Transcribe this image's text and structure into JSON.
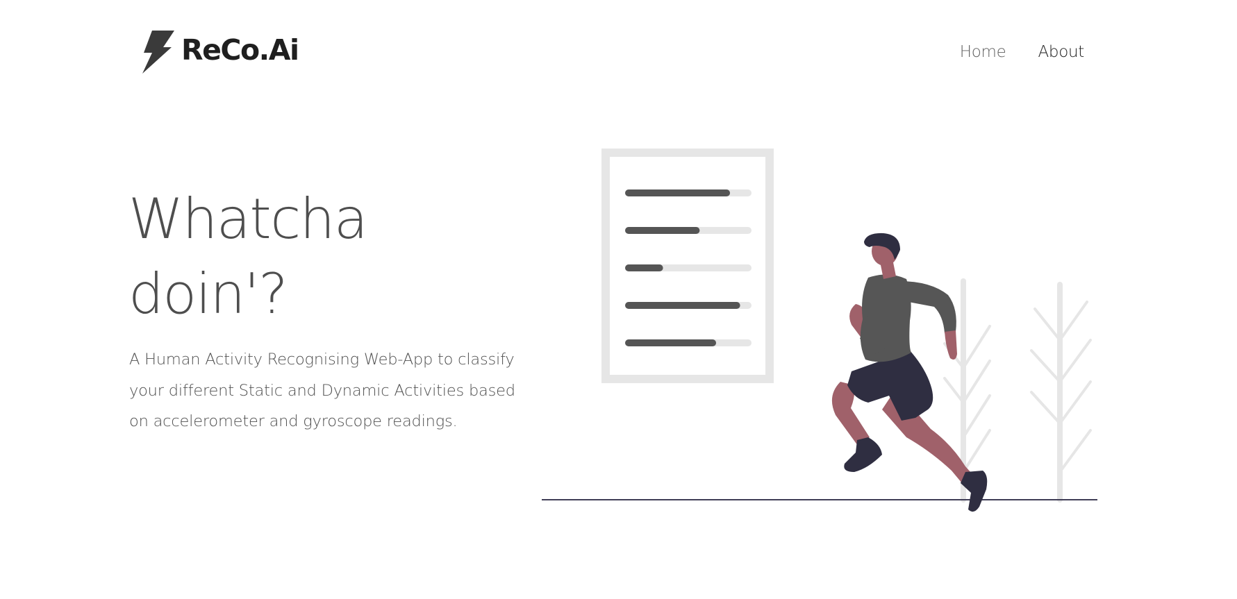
{
  "header": {
    "brand": "ReCo.Ai",
    "brand_icon": "lightning-bolt-icon",
    "nav": [
      {
        "label": "Home"
      },
      {
        "label": "About"
      }
    ]
  },
  "hero": {
    "title_line1": "Whatcha",
    "title_line2": "doin'?",
    "description": "A Human Activity Recognising Web-App to classify your different Static and Dynamic Activities based on accelerometer and gyroscope readings."
  },
  "illustration": {
    "subject": "runner-with-activity-chart",
    "progress_bars": [
      0.83,
      0.59,
      0.3,
      0.91,
      0.72
    ],
    "colors": {
      "bar_fill": "#555555",
      "bar_track": "#e6e6e6",
      "skin": "#a0616a",
      "shirt": "#565656",
      "shorts": "#2f2e41",
      "ground": "#3f3d56"
    }
  }
}
